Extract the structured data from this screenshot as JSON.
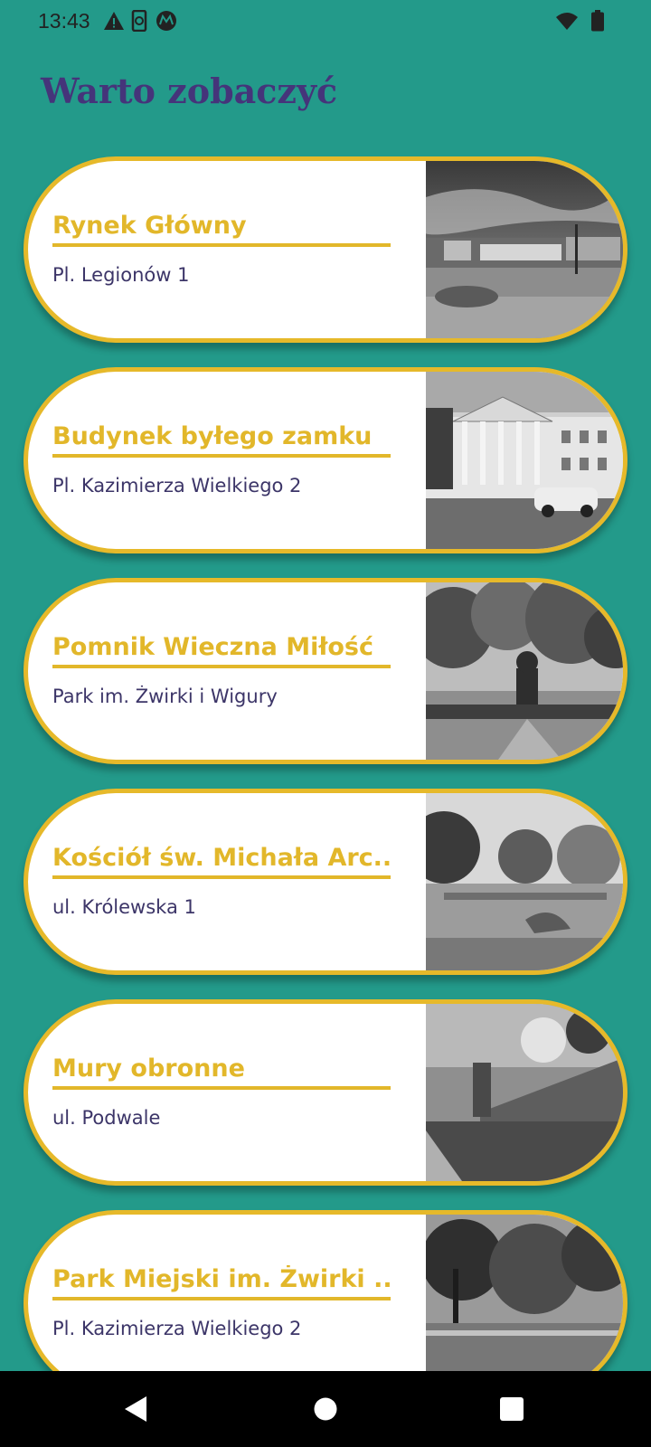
{
  "status_bar": {
    "time": "13:43",
    "left_icons": [
      "warning-icon",
      "phone-sync-icon",
      "motorola-icon"
    ],
    "right_icons": [
      "wifi-icon",
      "battery-icon"
    ]
  },
  "header": {
    "title": "Warto zobaczyć"
  },
  "places": [
    {
      "title": "Rynek Główny",
      "address": "Pl. Legionów 1",
      "photo": "town-square-photo"
    },
    {
      "title": "Budynek byłego zamku",
      "address": "Pl. Kazimierza Wielkiego 2",
      "photo": "castle-building-photo"
    },
    {
      "title": "Pomnik Wieczna Miłość",
      "address": "Park im. Żwirki i Wigury",
      "photo": "monument-park-photo"
    },
    {
      "title": "Kościół św. Michała Arc...",
      "address": "ul. Królewska 1",
      "photo": "church-ruins-photo"
    },
    {
      "title": "Mury obronne",
      "address": "ul. Podwale",
      "photo": "defensive-walls-photo"
    },
    {
      "title": "Park Miejski im. Żwirki ...",
      "address": "Pl. Kazimierza Wielkiego 2",
      "photo": "city-park-photo"
    }
  ],
  "nav": [
    "back-icon",
    "home-icon",
    "recents-icon"
  ],
  "colors": {
    "background": "#239A8A",
    "title": "#45347A",
    "card_border": "#E6B92A",
    "card_title": "#E2B72A",
    "card_address": "#3C3568"
  }
}
